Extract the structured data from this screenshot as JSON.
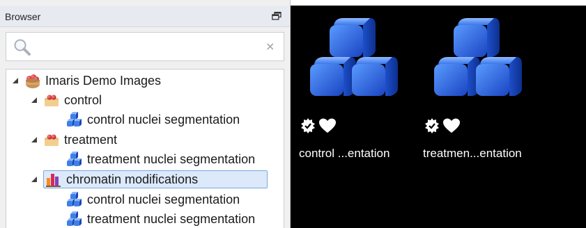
{
  "browser": {
    "title": "Browser",
    "search": {
      "value": "",
      "placeholder": "",
      "clear_glyph": "×"
    },
    "tree": [
      {
        "label": "Imaris Demo Images",
        "icon": "basket-icon",
        "expanded": true,
        "level": 0
      },
      {
        "label": "control",
        "icon": "folder-basket-icon",
        "expanded": true,
        "level": 1
      },
      {
        "label": "control nuclei segmentation",
        "icon": "cubes-icon",
        "level": 2
      },
      {
        "label": "treatment",
        "icon": "folder-basket-icon",
        "expanded": true,
        "level": 1
      },
      {
        "label": "treatment nuclei segmentation",
        "icon": "cubes-icon",
        "level": 2
      },
      {
        "label": "chromatin modifications",
        "icon": "bar-chart-icon",
        "expanded": true,
        "level": 1,
        "selected": true
      },
      {
        "label": "control nuclei segmentation",
        "icon": "cubes-icon",
        "level": 2
      },
      {
        "label": "treatment nuclei segmentation",
        "icon": "cubes-icon",
        "level": 2
      }
    ]
  },
  "viewer": {
    "thumbnails": [
      {
        "caption": "control ...entation",
        "badges": [
          "verified-gear-icon",
          "heart-icon"
        ]
      },
      {
        "caption": "treatmen...entation",
        "badges": [
          "verified-gear-icon",
          "heart-icon"
        ]
      }
    ]
  },
  "colors": {
    "panel_bg": "#f0f0f0",
    "header_bg": "#e7ebf1",
    "selection_bg": "#dbe9fb",
    "selection_border": "#7ba7dc",
    "cube_blue": "#2a64d8",
    "viewer_bg": "#000000"
  }
}
